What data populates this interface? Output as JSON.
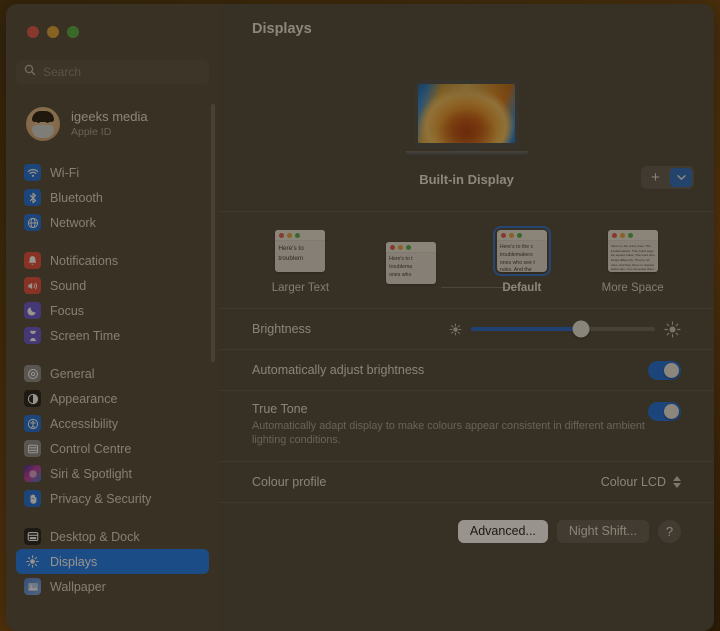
{
  "window": {
    "traffic_lights": [
      "close",
      "minimize",
      "maximize"
    ]
  },
  "sidebar": {
    "search": {
      "placeholder": "Search",
      "value": "",
      "icon": "search-icon"
    },
    "account": {
      "name": "igeeks media",
      "subtitle": "Apple ID",
      "avatar": "memoji-avatar"
    },
    "groups": [
      {
        "items": [
          {
            "label": "Wi-Fi",
            "icon": "wifi-icon",
            "icon_class": "ic-blue",
            "selected": false
          },
          {
            "label": "Bluetooth",
            "icon": "bluetooth-icon",
            "icon_class": "ic-blue",
            "selected": false
          },
          {
            "label": "Network",
            "icon": "network-icon",
            "icon_class": "ic-blue",
            "selected": false
          }
        ]
      },
      {
        "items": [
          {
            "label": "Notifications",
            "icon": "bell-icon",
            "icon_class": "ic-red",
            "selected": false
          },
          {
            "label": "Sound",
            "icon": "speaker-icon",
            "icon_class": "ic-red",
            "selected": false
          },
          {
            "label": "Focus",
            "icon": "moon-icon",
            "icon_class": "ic-purple",
            "selected": false
          },
          {
            "label": "Screen Time",
            "icon": "hourglass-icon",
            "icon_class": "ic-purple",
            "selected": false
          }
        ]
      },
      {
        "items": [
          {
            "label": "General",
            "icon": "gear-icon",
            "icon_class": "ic-grey",
            "selected": false
          },
          {
            "label": "Appearance",
            "icon": "contrast-icon",
            "icon_class": "ic-black",
            "selected": false
          },
          {
            "label": "Accessibility",
            "icon": "accessibility-icon",
            "icon_class": "ic-blue",
            "selected": false
          },
          {
            "label": "Control Centre",
            "icon": "sliders-icon",
            "icon_class": "ic-grey",
            "selected": false
          },
          {
            "label": "Siri & Spotlight",
            "icon": "siri-icon",
            "icon_class": "ic-siri",
            "selected": false
          },
          {
            "label": "Privacy & Security",
            "icon": "hand-icon",
            "icon_class": "ic-blue",
            "selected": false
          }
        ]
      },
      {
        "items": [
          {
            "label": "Desktop & Dock",
            "icon": "desktop-dock-icon",
            "icon_class": "ic-black",
            "selected": false
          },
          {
            "label": "Displays",
            "icon": "brightness-icon",
            "icon_class": "ic-sun",
            "selected": true
          },
          {
            "label": "Wallpaper",
            "icon": "wallpaper-icon",
            "icon_class": "ic-wall",
            "selected": false
          }
        ]
      }
    ],
    "scrollbar": "sidebar-scrollbar"
  },
  "main": {
    "title": "Displays",
    "display": {
      "name": "Built-in Display",
      "preview": "macbook-ventura-wallpaper",
      "add_button_label": "+",
      "add_dropdown_icon": "chevron-down-icon"
    },
    "resolution": {
      "options": [
        {
          "label": "Larger Text",
          "selected": false,
          "density": "big",
          "preview_text": [
            "Here's to",
            "troublem"
          ]
        },
        {
          "label": "",
          "selected": false,
          "density": "normal",
          "preview_text": [
            "Here's to t",
            "troublema",
            "ones who"
          ]
        },
        {
          "label": "Default",
          "selected": true,
          "density": "normal",
          "preview_text": [
            "Here's to the c",
            "troublemakers",
            "ones who see t",
            "rules. And the"
          ]
        },
        {
          "label": "More Space",
          "selected": false,
          "density": "dense",
          "preview_text": [
            "Here's to the crazy ones. The",
            "troublemakers. The round pegs",
            "the square holes. The ones who",
            "things differently. They're not",
            "rules. And they have no respect",
            "status quo. You can quote them,",
            "them, glorify or vilify them.",
            "thing you can't do is ignore them."
          ]
        }
      ]
    },
    "brightness": {
      "label": "Brightness",
      "value_percent": 60,
      "low_icon": "sun-small-icon",
      "high_icon": "sun-large-icon"
    },
    "auto_brightness": {
      "label": "Automatically adjust brightness",
      "enabled": true
    },
    "true_tone": {
      "label": "True Tone",
      "description": "Automatically adapt display to make colours appear consistent in different ambient lighting conditions.",
      "enabled": true
    },
    "colour_profile": {
      "label": "Colour profile",
      "value": "Colour LCD",
      "icon": "up-down-chevron-icon"
    },
    "buttons": {
      "advanced": "Advanced...",
      "night_shift": "Night Shift...",
      "help": "?"
    }
  },
  "colors": {
    "accent": "#1a7bf2",
    "slider_fill": "#2068cf",
    "toggle_on": "#1a6ee0",
    "sidebar_bg": "#504a3d",
    "main_bg": "#4d4840"
  }
}
